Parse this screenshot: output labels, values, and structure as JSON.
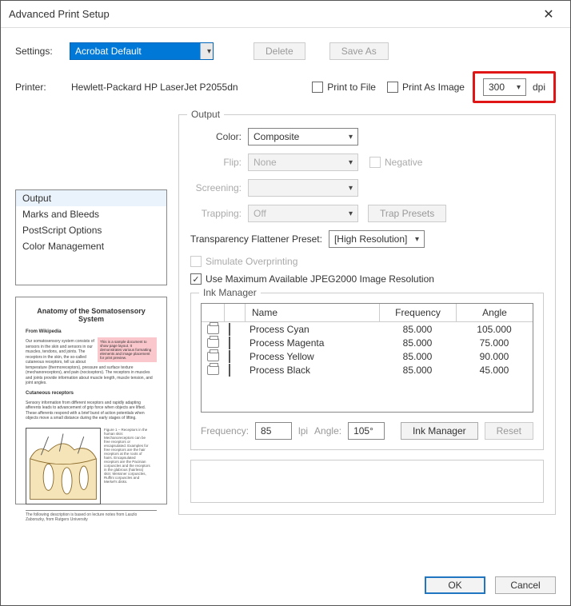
{
  "window": {
    "title": "Advanced Print Setup"
  },
  "toolbar": {
    "settings_label": "Settings:",
    "settings_value": "Acrobat Default",
    "delete": "Delete",
    "save_as": "Save As",
    "printer_label": "Printer:",
    "printer_name": "Hewlett-Packard HP LaserJet P2055dn",
    "print_to_file": "Print to File",
    "print_as_image": "Print As Image",
    "dpi_value": "300",
    "dpi_unit": "dpi"
  },
  "sections": {
    "items": [
      "Output",
      "Marks and Bleeds",
      "PostScript Options",
      "Color Management"
    ],
    "selected": 0
  },
  "preview": {
    "title": "Anatomy of the Somatosensory System",
    "subtitle": "From Wikipedia",
    "para1": "Our somatosensory system consists of sensors in the skin and sensors in our muscles, tendons, and joints. The receptors in the skin, the so-called cutaneous receptors, tell us about temperature (thermoreceptors), pressure and surface texture (mechanoreceptors), and pain (nociceptors). The receptors in muscles and joints provide information about muscle length, muscle tension, and joint angles.",
    "pink": "This is a sample document to show page layout. It demonstrates various formatting elements and image placement for print preview.",
    "heading2": "Cutaneous receptors",
    "para2": "Sensory information from different receptors and rapidly adapting afferents leads to advancement of grip force when objects are lifted. These afferents respond with a brief burst of action potentials when objects move a small distance during the early stages of lifting.",
    "figcap": "Figure 1 – Receptors in the human skin: Mechanoreceptors can be free receptors or encapsulated. Examples for free receptors are the hair receptors at the roots of hairs. Encapsulated receptors are the Pacinian corpuscles and the receptors in the glabrous (hairless) skin: Meissner corpuscles, Ruffini corpuscles and Merkel's disks.",
    "footnote": "The following description is based on lecture notes from Laszlo Zaborszky, from Rutgers University"
  },
  "output": {
    "group_title": "Output",
    "color_label": "Color:",
    "color_value": "Composite",
    "flip_label": "Flip:",
    "flip_value": "None",
    "negative_label": "Negative",
    "screening_label": "Screening:",
    "trapping_label": "Trapping:",
    "trapping_value": "Off",
    "trap_presets_btn": "Trap Presets",
    "flattener_label": "Transparency Flattener Preset:",
    "flattener_value": "[High Resolution]",
    "simulate_label": "Simulate Overprinting",
    "jpeg2000_label": "Use Maximum Available JPEG2000 Image Resolution"
  },
  "ink": {
    "group_title": "Ink Manager",
    "head": {
      "name": "Name",
      "freq": "Frequency",
      "angle": "Angle"
    },
    "rows": [
      {
        "name": "Process Cyan",
        "color": "#24d4e8",
        "freq": "85.000",
        "angle": "105.000"
      },
      {
        "name": "Process Magenta",
        "color": "#e4007f",
        "freq": "85.000",
        "angle": "75.000"
      },
      {
        "name": "Process Yellow",
        "color": "#fff200",
        "freq": "85.000",
        "angle": "90.000"
      },
      {
        "name": "Process Black",
        "color": "#000000",
        "freq": "85.000",
        "angle": "45.000"
      }
    ],
    "freq_label": "Frequency:",
    "freq_value": "85",
    "freq_unit": "lpi",
    "angle_label": "Angle:",
    "angle_value": "105°",
    "ink_mgr_btn": "Ink Manager",
    "reset_btn": "Reset"
  },
  "footer": {
    "ok": "OK",
    "cancel": "Cancel"
  }
}
